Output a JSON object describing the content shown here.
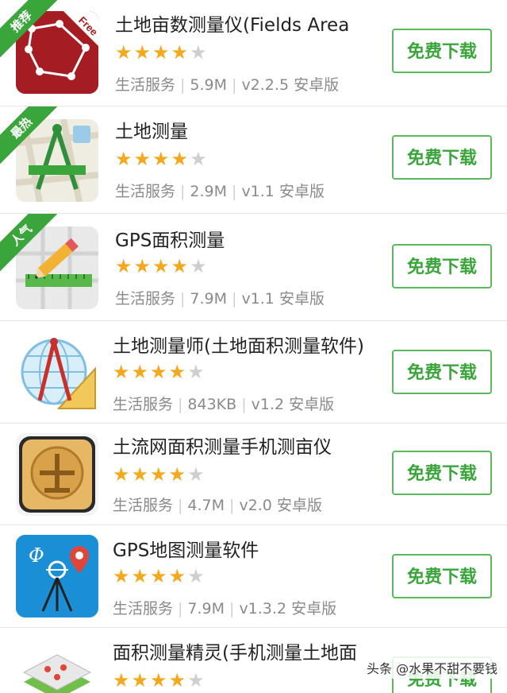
{
  "apps": [
    {
      "title": "土地亩数测量仪(Fields Area",
      "badge": "推荐",
      "category": "生活服务",
      "size": "5.9M",
      "version": "v2.2.5 安卓版",
      "stars": 4,
      "button": "免费下载",
      "icon_label": "Free",
      "icon": "polygon-map-icon"
    },
    {
      "title": "土地测量",
      "badge": "最热",
      "category": "生活服务",
      "size": "2.9M",
      "version": "v1.1 安卓版",
      "stars": 4,
      "button": "免费下载",
      "icon": "compass-ruler-map-icon"
    },
    {
      "title": "GPS面积测量",
      "badge": "人气",
      "category": "生活服务",
      "size": "7.9M",
      "version": "v1.1 安卓版",
      "stars": 4,
      "button": "免费下载",
      "icon": "pencil-ruler-icon"
    },
    {
      "title": "土地测量师(土地面积测量软件)",
      "badge": "",
      "category": "生活服务",
      "size": "843KB",
      "version": "v1.2 安卓版",
      "stars": 4,
      "button": "免费下载",
      "icon": "globe-compass-icon"
    },
    {
      "title": "土流网面积测量手机测亩仪",
      "badge": "",
      "category": "生活服务",
      "size": "4.7M",
      "version": "v2.0 安卓版",
      "stars": 4,
      "button": "免费下载",
      "icon": "land-emblem-icon"
    },
    {
      "title": "GPS地图测量软件",
      "badge": "",
      "category": "生活服务",
      "size": "7.9M",
      "version": "v1.3.2 安卓版",
      "stars": 4,
      "button": "免费下载",
      "icon_label": "Φ",
      "icon": "theodolite-pin-icon"
    },
    {
      "title": "面积测量精灵(手机测量土地面",
      "badge": "",
      "category": "",
      "size": "",
      "version": "",
      "stars": 4,
      "button": "免费下载",
      "icon": "map-layers-icon"
    }
  ],
  "watermark": "头条 @水果不甜不要钱",
  "colors": {
    "accent": "#3aa53a",
    "star": "#f4a81e",
    "star_off": "#cfcfcf"
  }
}
